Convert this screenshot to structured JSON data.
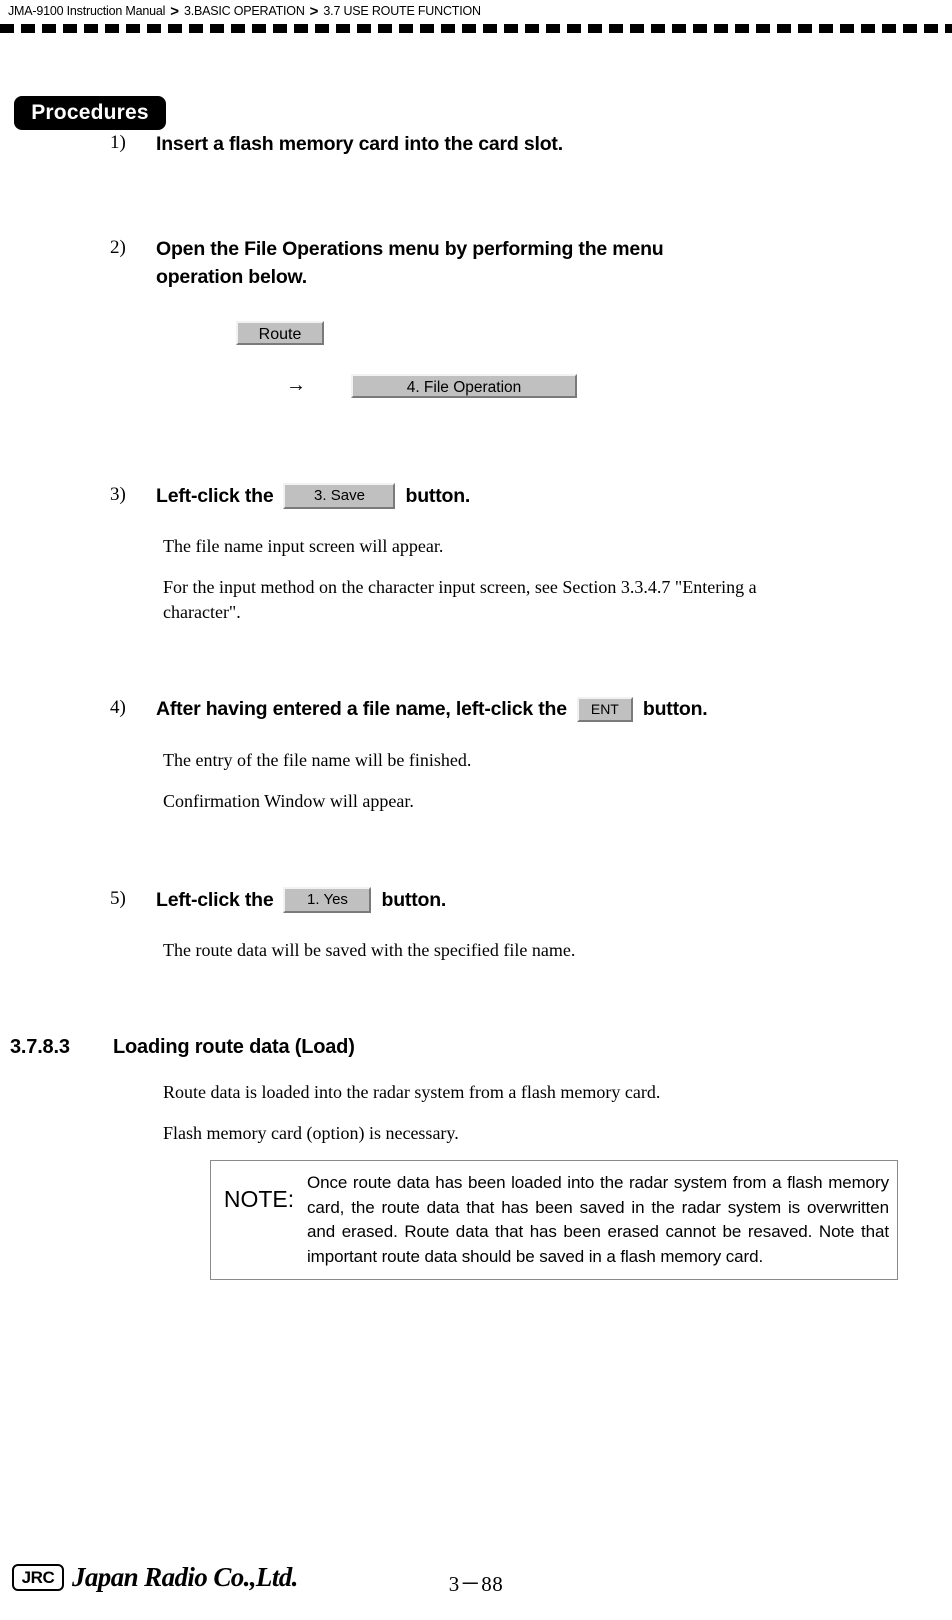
{
  "header": {
    "manual": "JMA-9100 Instruction Manual",
    "separator": ">",
    "chapter": "3.BASIC OPERATION",
    "section": "3.7  USE ROUTE FUNCTION"
  },
  "procedures": {
    "badge_label": "Procedures",
    "steps": [
      {
        "number": "1)",
        "title": "Insert a flash memory card into the card slot."
      },
      {
        "number": "2)",
        "title_line1": "Open the File Operations menu by performing the menu",
        "title_line2": "operation below.",
        "menu_path": {
          "button1": "Route",
          "arrow": "→",
          "button2": "4. File Operation"
        }
      },
      {
        "number": "3)",
        "title_before": "Left-click the",
        "button": "3. Save",
        "title_after": "button.",
        "body1": "The file name input screen will appear.",
        "body2_line1": "For the input method on the character input screen, see Section 3.3.4.7 \"Entering a",
        "body2_line2": "character\"."
      },
      {
        "number": "4)",
        "title_before": "After having entered a file name, left-click the",
        "button": "ENT",
        "title_after": "button.",
        "body1": "The entry of the file name will be finished.",
        "body2": "Confirmation Window will appear."
      },
      {
        "number": "5)",
        "title_before": "Left-click the",
        "button": "1. Yes",
        "title_after": "button.",
        "body1": "The route data will be saved with the specified file name."
      }
    ]
  },
  "section": {
    "number": "3.7.8.3",
    "title": "Loading route data (Load)",
    "para1": "Route data is loaded into the radar system from a flash memory card.",
    "para2": "Flash memory card (option) is necessary.",
    "note": {
      "label": "NOTE:",
      "text": "Once route data has been loaded into the radar system from a flash memory card, the route data that has been saved in the radar system is overwritten and erased. Route data that has been erased cannot be resaved. Note that important route data should be saved in a flash memory card."
    }
  },
  "footer": {
    "logo_text": "JRC",
    "company": "Japan Radio Co.,Ltd.",
    "page_number": "3－88"
  }
}
